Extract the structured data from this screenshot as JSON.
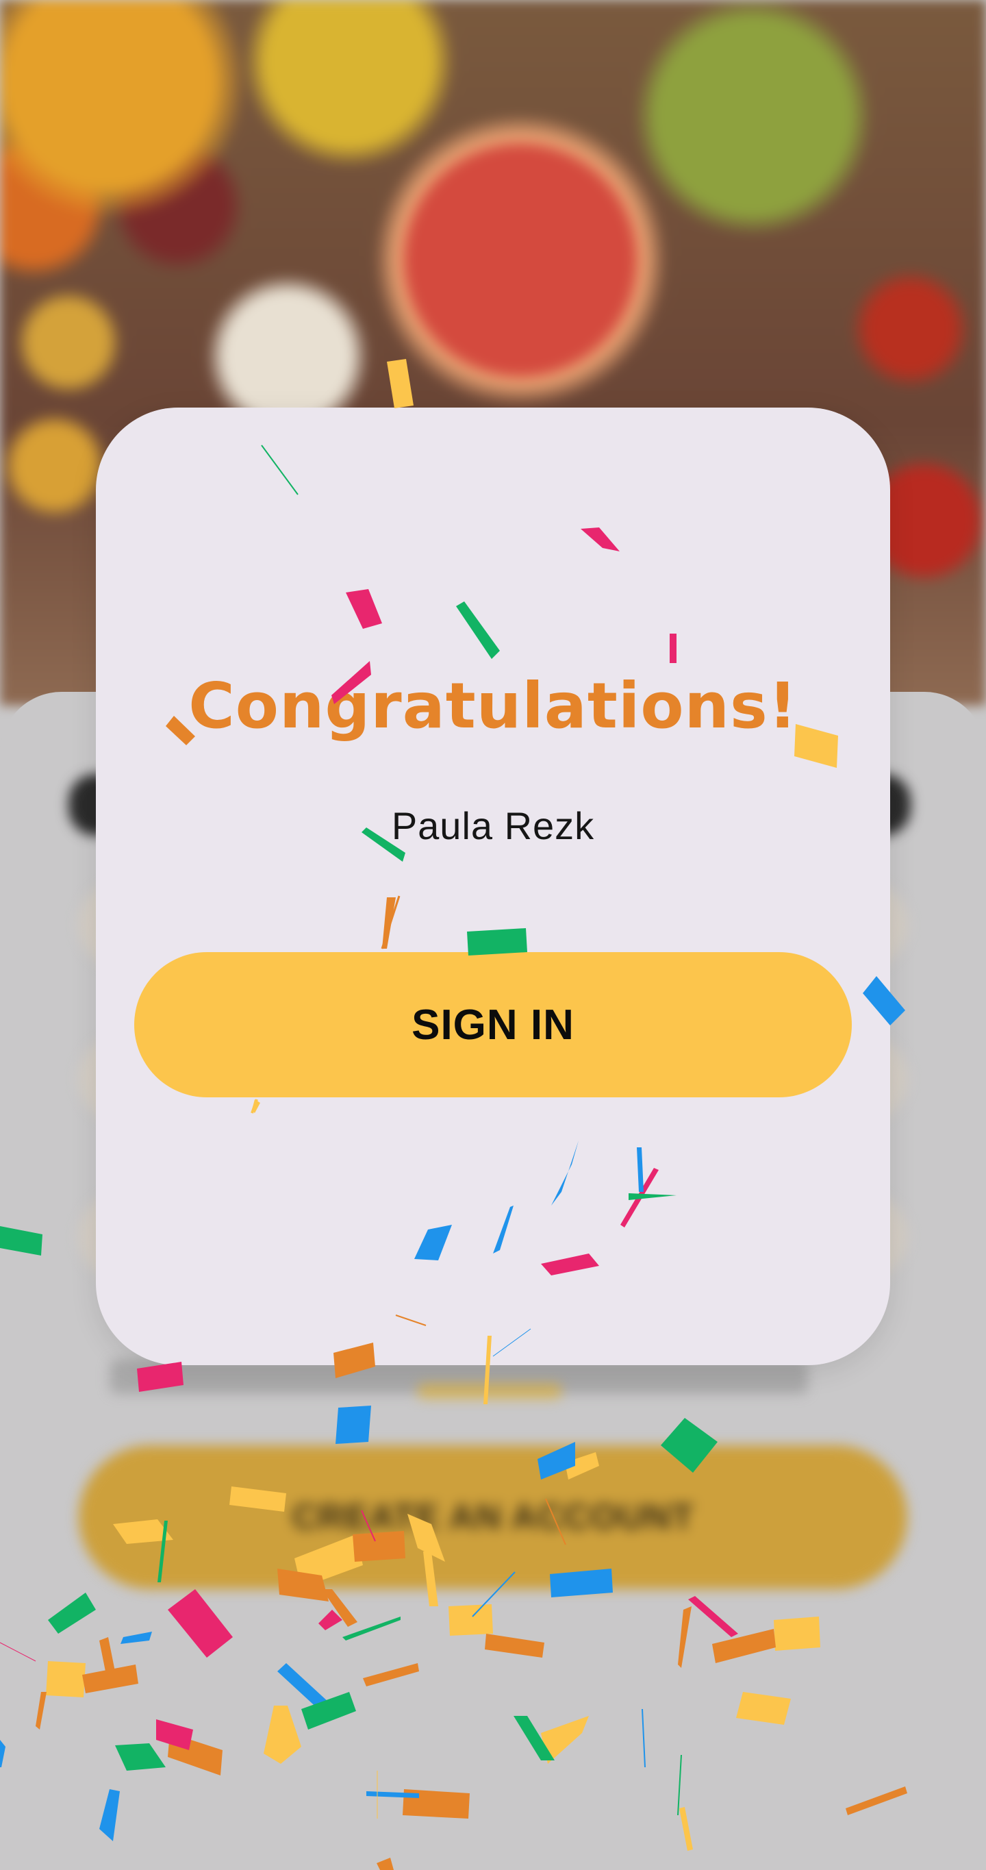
{
  "dialog": {
    "title": "Congratulations!",
    "user_name": "Paula Rezk",
    "sign_in_label": "SIGN IN"
  },
  "background_screen": {
    "create_account_label": "CREATE AN ACCOUNT"
  },
  "colors": {
    "accent_orange": "#e5842a",
    "button_yellow": "#fcc54c",
    "card_background": "#ebe6ee",
    "confetti": [
      "#fcc54c",
      "#e5842a",
      "#e8266e",
      "#1f93eb",
      "#12b364"
    ]
  }
}
